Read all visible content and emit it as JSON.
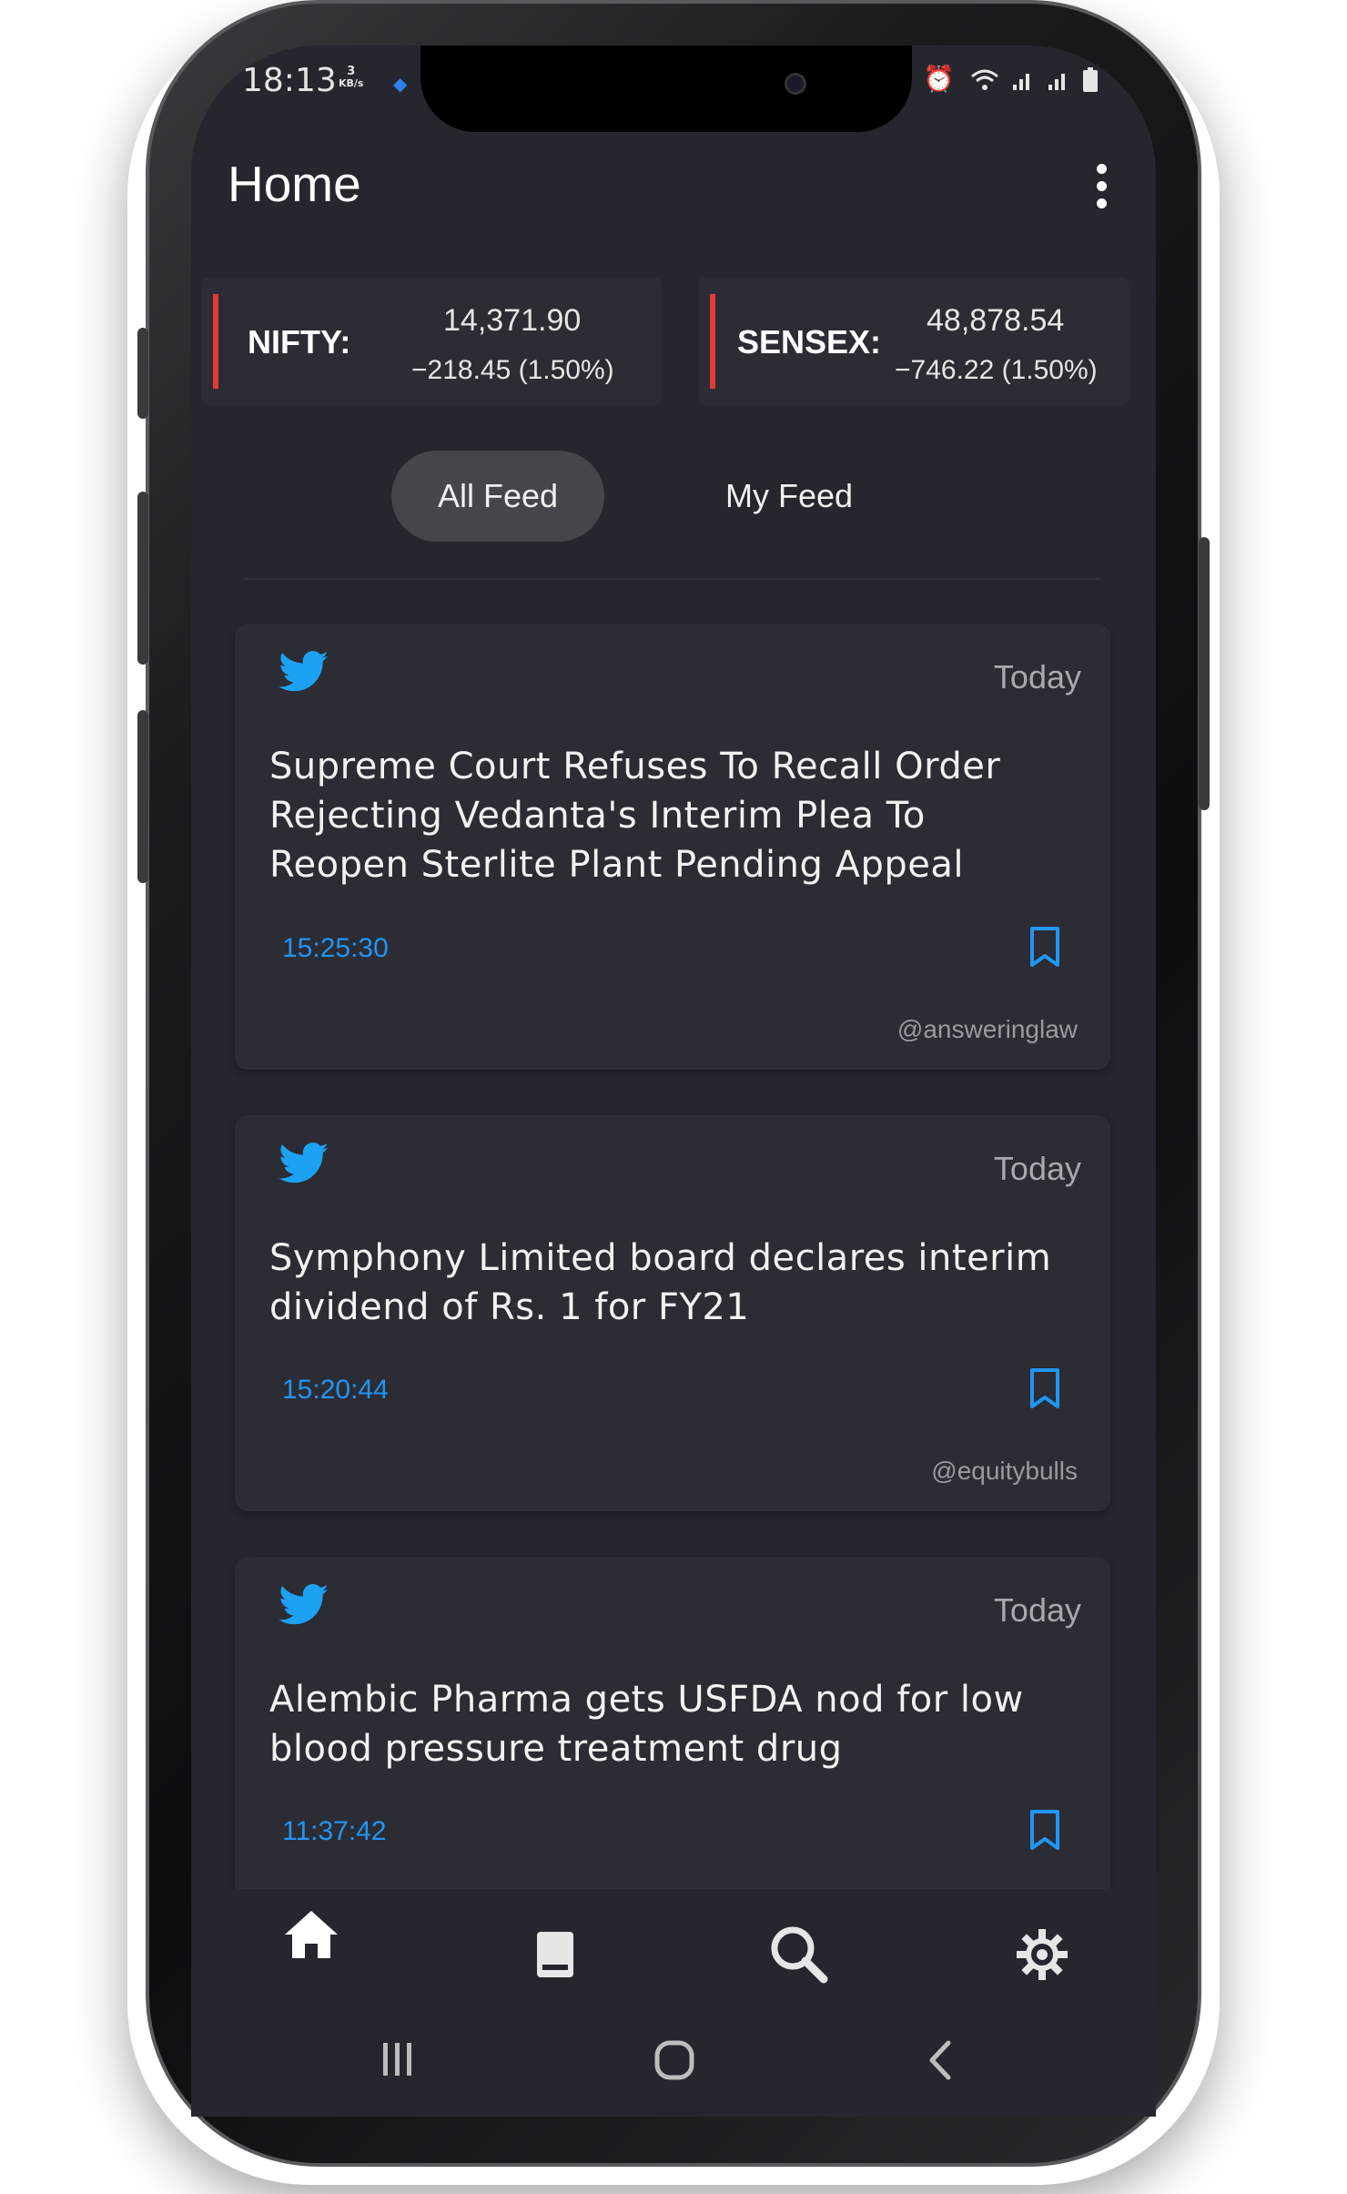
{
  "status_bar": {
    "time": "18:13",
    "speed_value": "3",
    "speed_unit": "KB/s",
    "icons": [
      "alarm-icon",
      "wifi-icon",
      "signal-icon",
      "signal-icon",
      "battery-icon"
    ]
  },
  "app_bar": {
    "title": "Home",
    "menu_icon": "more-vert-icon"
  },
  "indices": [
    {
      "label": "NIFTY:",
      "value": "14,371.90",
      "change": "−218.45 (1.50%)",
      "trend_color": "#e53935"
    },
    {
      "label": "SENSEX:",
      "value": "48,878.54",
      "change": "−746.22 (1.50%)",
      "trend_color": "#e53935"
    }
  ],
  "feed_tabs": [
    {
      "label": "All Feed",
      "selected": true
    },
    {
      "label": "My Feed",
      "selected": false
    }
  ],
  "feed": [
    {
      "source_icon": "twitter-icon",
      "date": "Today",
      "headline": "Supreme Court Refuses To Recall Order Rejecting Vedanta's Interim Plea To Reopen Sterlite Plant Pending Appeal",
      "time": "15:25:30",
      "handle": "@answeringlaw"
    },
    {
      "source_icon": "twitter-icon",
      "date": "Today",
      "headline": "Symphony Limited board declares interim dividend of Rs. 1 for FY21",
      "time": "15:20:44",
      "handle": "@equitybulls"
    },
    {
      "source_icon": "twitter-icon",
      "date": "Today",
      "headline": "Alembic Pharma gets USFDA nod for low blood pressure treatment drug",
      "time": "11:37:42",
      "handle": ""
    }
  ],
  "bottom_nav": [
    {
      "icon": "home-icon",
      "active": true
    },
    {
      "icon": "book-icon",
      "active": false
    },
    {
      "icon": "search-icon",
      "active": false
    },
    {
      "icon": "settings-icon",
      "active": false
    }
  ],
  "system_nav": [
    "recents-icon",
    "home-circle-icon",
    "back-icon"
  ],
  "colors": {
    "background": "#25262e",
    "card": "#2b2c34",
    "accent": "#2196f3",
    "twitter": "#1da1f2",
    "negative": "#e53935"
  }
}
